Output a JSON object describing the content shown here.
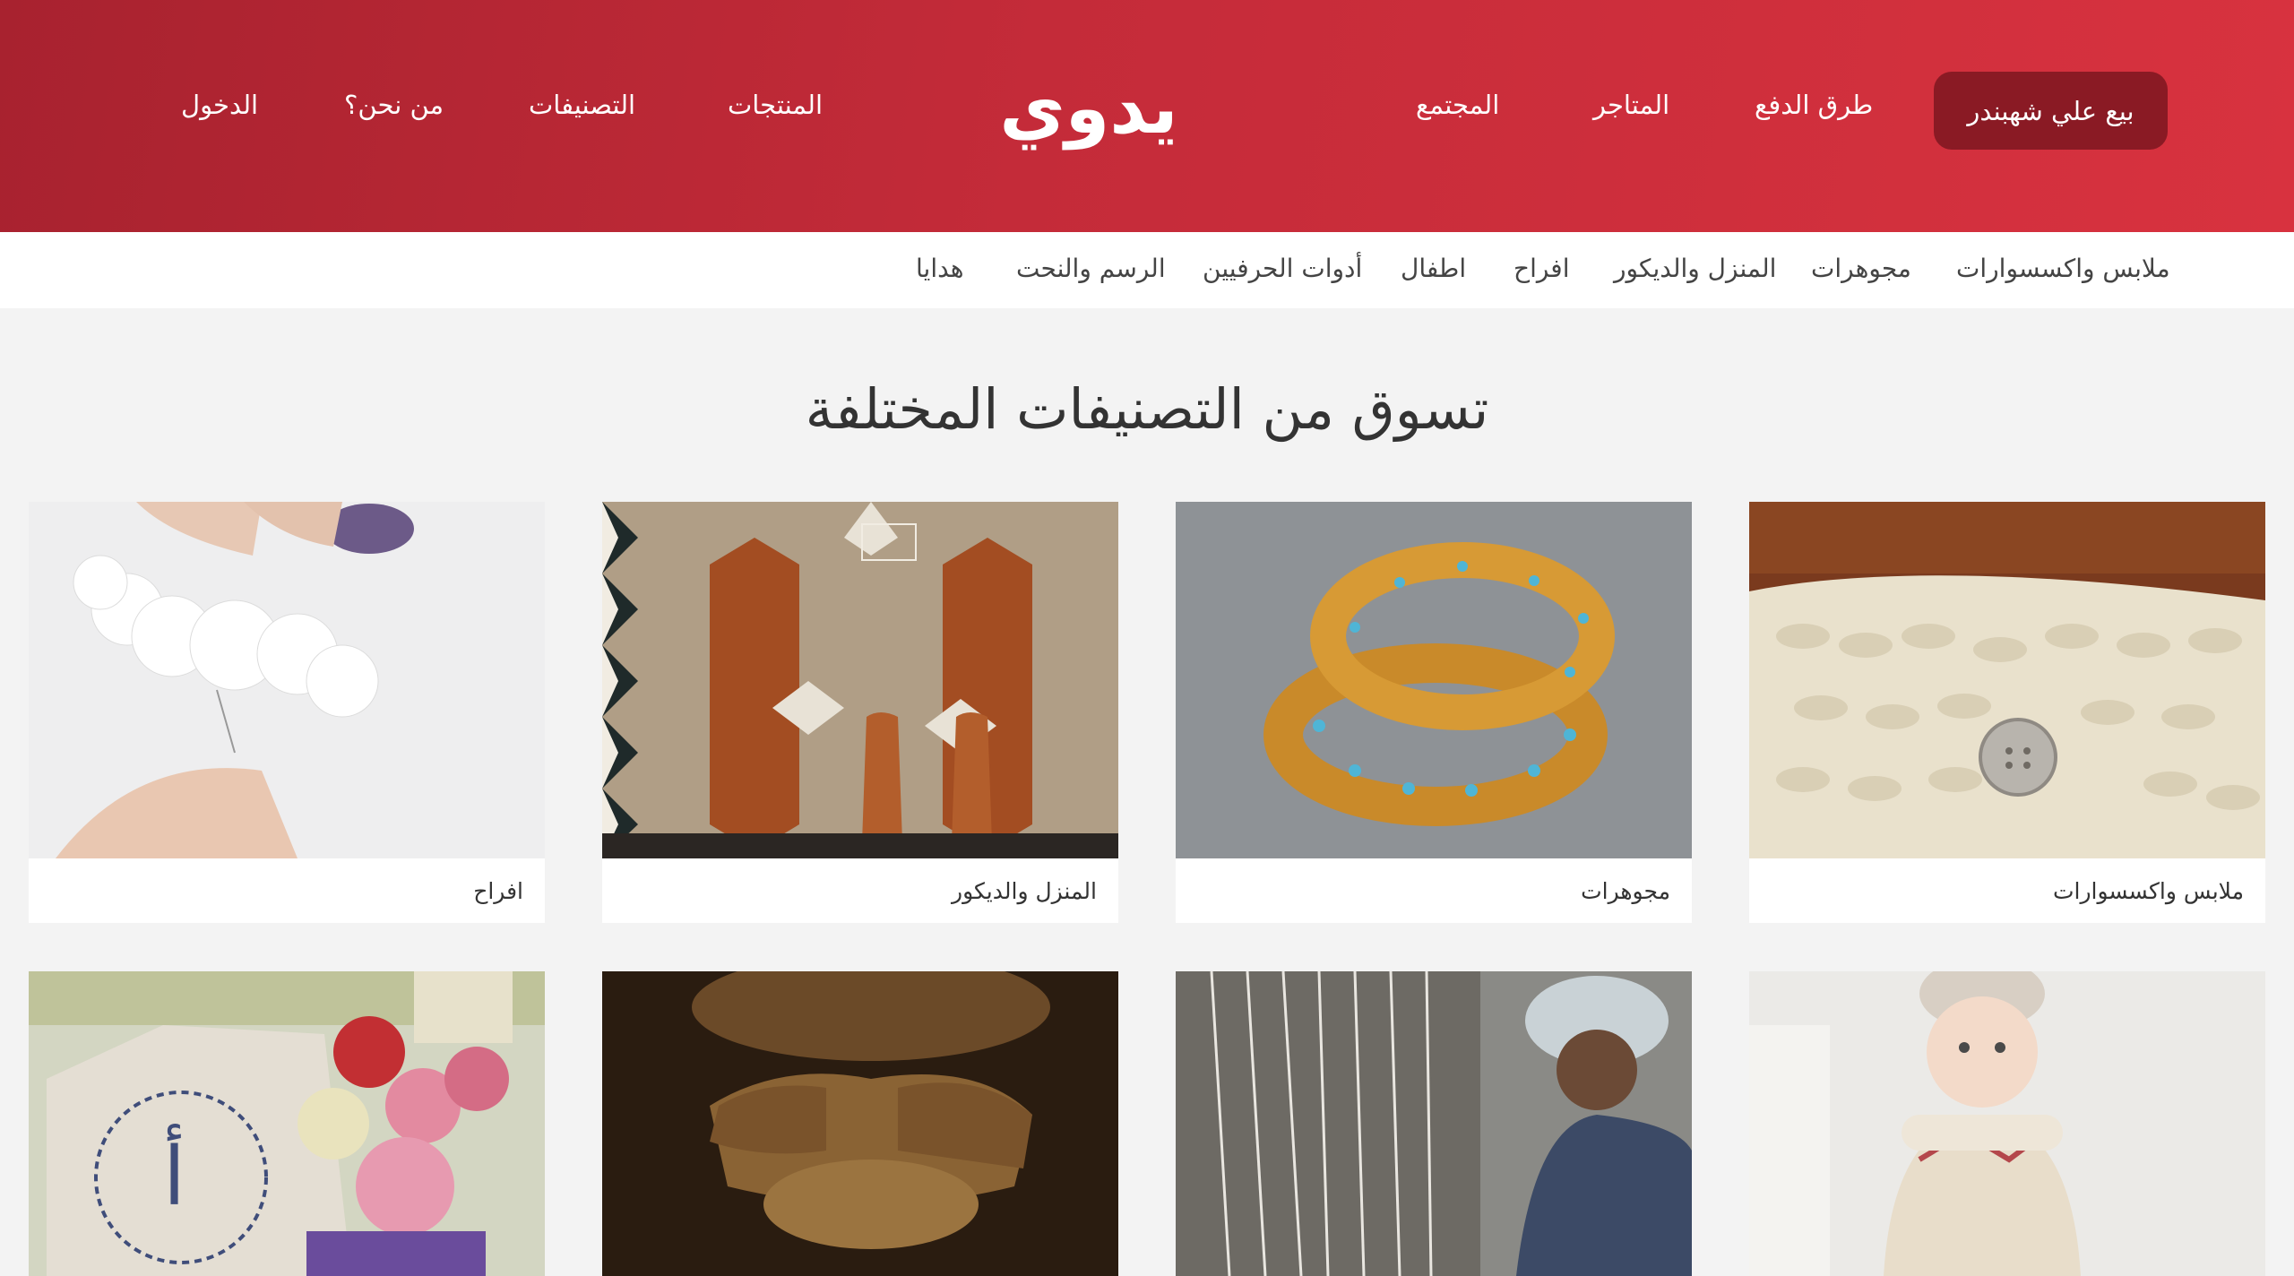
{
  "header": {
    "logo_text": "يدوي",
    "sell_button": "بيع علي شهبندر",
    "nav_right": [
      "طرق الدفع",
      "المتاجر",
      "المجتمع"
    ],
    "nav_left": [
      "المنتجات",
      "التصنيفات",
      "من نحن؟",
      "الدخول"
    ]
  },
  "subnav": {
    "items": [
      "ملابس واكسسوارات",
      "مجوهرات",
      "المنزل والديكور",
      "افراح",
      "اطفال",
      "أدوات الحرفيين",
      "الرسم والنحت",
      "هدايا"
    ]
  },
  "main": {
    "title": "تسوق من التصنيفات المختلفة",
    "cards": [
      {
        "label": "ملابس واكسسوارات"
      },
      {
        "label": "مجوهرات"
      },
      {
        "label": "المنزل والديكور"
      },
      {
        "label": "افراح"
      }
    ]
  },
  "colors": {
    "header_start": "#a8222f",
    "header_end": "#d8323f",
    "sell_button_bg": "#8a1a24",
    "page_bg": "#f3f3f3"
  }
}
